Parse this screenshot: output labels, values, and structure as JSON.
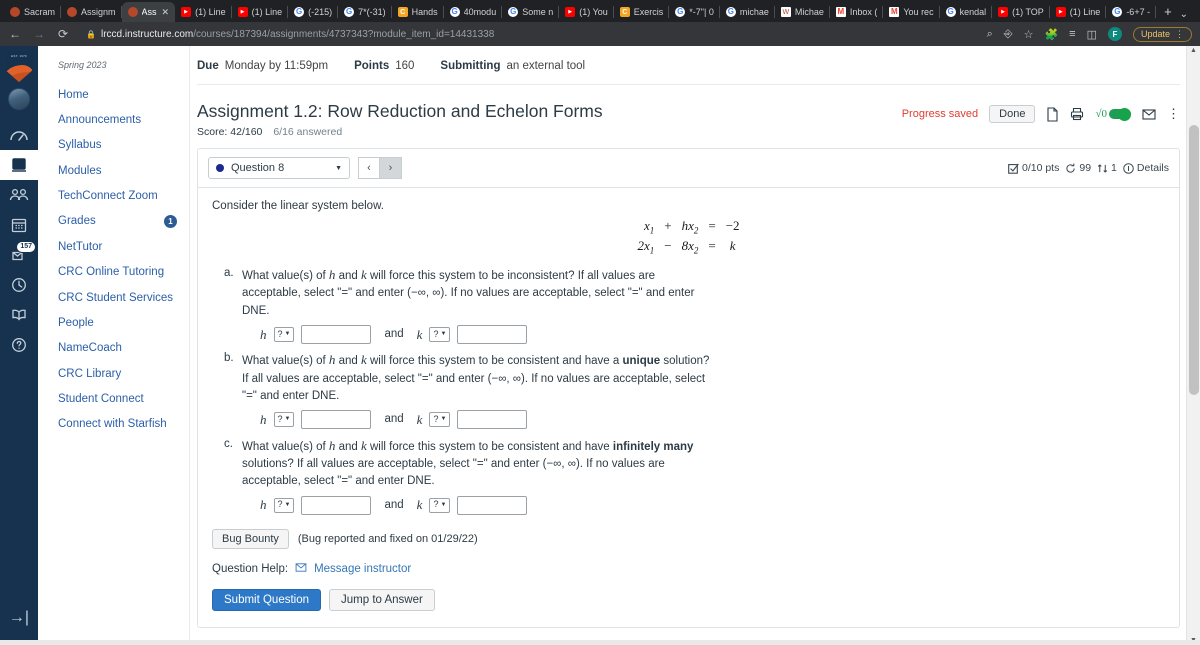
{
  "browser": {
    "tabs": [
      {
        "title": "Sacram",
        "favicon": "canvas-icon",
        "active": false
      },
      {
        "title": "Assignm",
        "favicon": "canvas-icon",
        "active": false
      },
      {
        "title": "Ass",
        "favicon": "canvas-icon",
        "active": true
      },
      {
        "title": "(1) Line",
        "favicon": "youtube-icon",
        "active": false
      },
      {
        "title": "(1) Line",
        "favicon": "youtube-icon",
        "active": false
      },
      {
        "title": "(-215)",
        "favicon": "google-icon",
        "active": false
      },
      {
        "title": "7*(-31)",
        "favicon": "google-icon",
        "active": false
      },
      {
        "title": "Hands",
        "favicon": "canvas-orange-icon",
        "active": false
      },
      {
        "title": "40modu",
        "favicon": "google-icon",
        "active": false
      },
      {
        "title": "Some n",
        "favicon": "google-icon",
        "active": false
      },
      {
        "title": "(1) You",
        "favicon": "youtube-icon",
        "active": false
      },
      {
        "title": "Exercis",
        "favicon": "canvas-orange-icon",
        "active": false
      },
      {
        "title": "*-7\"| 0",
        "favicon": "google-icon",
        "active": false
      },
      {
        "title": "michae",
        "favicon": "google-icon",
        "active": false
      },
      {
        "title": "Michae",
        "favicon": "word-icon",
        "active": false
      },
      {
        "title": "Inbox (",
        "favicon": "gmail-icon",
        "active": false
      },
      {
        "title": "You rec",
        "favicon": "gmail-icon",
        "active": false
      },
      {
        "title": "kendal",
        "favicon": "google-icon",
        "active": false
      },
      {
        "title": "(1) TOP",
        "favicon": "youtube-icon",
        "active": false
      },
      {
        "title": "(1) Line",
        "favicon": "youtube-icon",
        "active": false
      },
      {
        "title": "-6+7 -",
        "favicon": "google-icon",
        "active": false
      }
    ],
    "new_tab_label": "+",
    "window_controls": [
      "⌄",
      "−",
      "❐",
      "✕"
    ],
    "back_label": "←",
    "forward_label": "→",
    "reload_label": "⟳",
    "url_domain": "lrccd.instructure.com",
    "url_path": "/courses/187394/assignments/4737343?module_item_id=14431338",
    "profile_initial": "F",
    "update_label": "Update"
  },
  "global_nav": {
    "logo_text": "EST. 1970",
    "items": [
      {
        "name": "dashboard",
        "label": "Dashboard"
      },
      {
        "name": "courses",
        "label": "Courses"
      },
      {
        "name": "groups",
        "label": "Groups"
      },
      {
        "name": "calendar",
        "label": "Calendar"
      },
      {
        "name": "inbox",
        "label": "Inbox",
        "badge": "157"
      },
      {
        "name": "history",
        "label": "History"
      },
      {
        "name": "commons",
        "label": "Commons"
      },
      {
        "name": "help",
        "label": "Help"
      }
    ],
    "collapse_label": "→|"
  },
  "course_nav": {
    "term": "Spring 2023",
    "items": [
      {
        "label": "Home"
      },
      {
        "label": "Announcements"
      },
      {
        "label": "Syllabus"
      },
      {
        "label": "Modules"
      },
      {
        "label": "TechConnect Zoom"
      },
      {
        "label": "Grades",
        "badge": "1"
      },
      {
        "label": "NetTutor"
      },
      {
        "label": "CRC Online Tutoring"
      },
      {
        "label": "CRC Student Services"
      },
      {
        "label": "People"
      },
      {
        "label": "NameCoach"
      },
      {
        "label": "CRC Library"
      },
      {
        "label": "Student Connect"
      },
      {
        "label": "Connect with Starfish"
      }
    ]
  },
  "assignment": {
    "due_label": "Due",
    "due_value": "Monday by 11:59pm",
    "points_label": "Points",
    "points_value": "160",
    "submitting_label": "Submitting",
    "submitting_value": "an external tool",
    "title": "Assignment 1.2: Row Reduction and Echelon Forms",
    "score_text": "Score: 42/160",
    "answered_text": "6/16 answered"
  },
  "tools": {
    "progress_saved": "Progress saved",
    "done_label": "Done",
    "icons": [
      "document-icon",
      "print-icon",
      "sqrt-toggle-icon",
      "mail-icon",
      "kebab-menu-icon"
    ],
    "sqrt_label": "√0"
  },
  "question": {
    "selected": "Question 8",
    "prev_label": "‹",
    "next_label": "›",
    "stats": {
      "points": "0/10 pts",
      "retries": "99",
      "swaps": "1",
      "details": "Details"
    },
    "prompt": "Consider the linear system below.",
    "system": {
      "rows": [
        {
          "term1": "x",
          "term1_sub": "1",
          "op": "+",
          "term2_coef": "h",
          "term2": "x",
          "term2_sub": "2",
          "eq": "=",
          "rhs": "−2"
        },
        {
          "term1_coef": "2",
          "term1": "x",
          "term1_sub": "1",
          "op": "−",
          "term2_coef": "8",
          "term2": "x",
          "term2_sub": "2",
          "eq": "=",
          "rhs": "k"
        }
      ]
    },
    "parts": [
      {
        "text_before": "What value(s) of ",
        "var1": "h",
        "text_mid": " and ",
        "var2": "k",
        "text_after": " will force this system to be inconsistent? If all values are acceptable, select \"=\" and enter (−∞, ∞). If no values are acceptable, select \"=\" and enter DNE.",
        "label_h": "h",
        "label_k": "k",
        "and_label": "and",
        "select_value": "?",
        "input_h": "",
        "input_k": ""
      },
      {
        "text_before": "What value(s) of ",
        "var1": "h",
        "text_mid": " and ",
        "var2": "k",
        "text_after": " will force this system to be consistent and have a ",
        "bold_word": "unique",
        "text_end": " solution? If all values are acceptable, select \"=\" and enter (−∞, ∞). If no values are acceptable, select \"=\" and enter DNE.",
        "label_h": "h",
        "label_k": "k",
        "and_label": "and",
        "select_value": "?",
        "input_h": "",
        "input_k": ""
      },
      {
        "text_before": "What value(s) of ",
        "var1": "h",
        "text_mid": " and ",
        "var2": "k",
        "text_after": " will force this system to be consistent and have ",
        "bold_word": "infinitely many",
        "text_end": " solutions? If all values are acceptable, select \"=\" and enter (−∞, ∞). If no values are acceptable, select \"=\" and enter DNE.",
        "label_h": "h",
        "label_k": "k",
        "and_label": "and",
        "select_value": "?",
        "input_h": "",
        "input_k": ""
      }
    ],
    "bug_bounty_label": "Bug Bounty",
    "bug_bounty_note": "(Bug reported and fixed on 01/29/22)",
    "question_help_label": "Question Help:",
    "message_instructor_label": "Message instructor",
    "submit_label": "Submit Question",
    "jump_label": "Jump to Answer"
  },
  "colors": {
    "canvas_blue": "#2b5fa8",
    "nav_dark": "#17324e",
    "primary_button": "#2d79c7",
    "alert_red": "#e03c31",
    "toggle_green": "#1f9d55"
  }
}
